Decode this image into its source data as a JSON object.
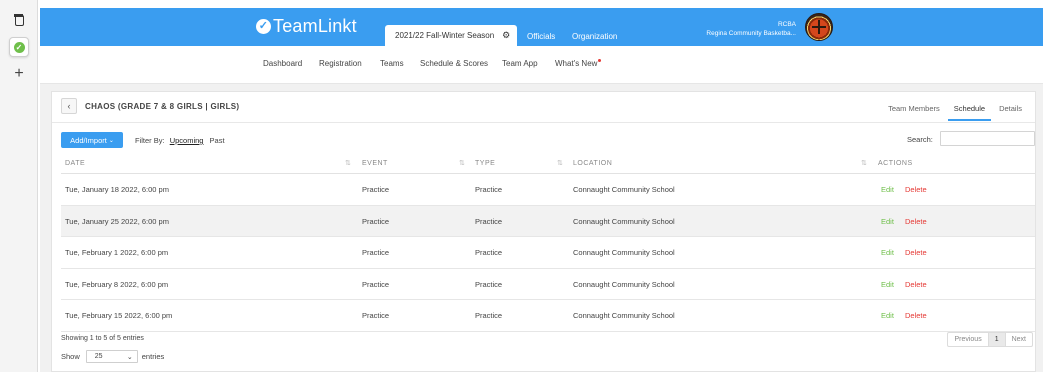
{
  "header": {
    "brand": "TeamLinkt",
    "season": "2021/22 Fall-Winter Season",
    "links": {
      "officials": "Officials",
      "organization": "Organization"
    },
    "org_abbrev": "RCBA",
    "org_name": "Regina Community Basketba..."
  },
  "subnav": {
    "dashboard": "Dashboard",
    "registration": "Registration",
    "teams": "Teams",
    "schedule": "Schedule & Scores",
    "team_app": "Team App",
    "whats_new": "What's New"
  },
  "team": {
    "title": "CHAOS (GRADE 7 & 8 GIRLS | GIRLS)",
    "tabs": {
      "members": "Team Members",
      "schedule": "Schedule",
      "details": "Details"
    }
  },
  "toolbar": {
    "add_import": "Add/Import",
    "filter_label": "Filter By:",
    "filter_upcoming": "Upcoming",
    "filter_past": "Past",
    "search_label": "Search:",
    "search_value": ""
  },
  "table": {
    "headers": {
      "date": "DATE",
      "event": "EVENT",
      "type": "TYPE",
      "location": "LOCATION",
      "actions": "ACTIONS"
    },
    "action_edit": "Edit",
    "action_delete": "Delete",
    "rows": [
      {
        "date": "Tue, January 18 2022, 6:00 pm",
        "event": "Practice",
        "type": "Practice",
        "location": "Connaught Community School"
      },
      {
        "date": "Tue, January 25 2022, 6:00 pm",
        "event": "Practice",
        "type": "Practice",
        "location": "Connaught Community School"
      },
      {
        "date": "Tue, February 1 2022, 6:00 pm",
        "event": "Practice",
        "type": "Practice",
        "location": "Connaught Community School"
      },
      {
        "date": "Tue, February 8 2022, 6:00 pm",
        "event": "Practice",
        "type": "Practice",
        "location": "Connaught Community School"
      },
      {
        "date": "Tue, February 15 2022, 6:00 pm",
        "event": "Practice",
        "type": "Practice",
        "location": "Connaught Community School"
      }
    ]
  },
  "footer": {
    "showing": "Showing 1 to 5 of 5 entries",
    "show_label": "Show",
    "length_value": "25",
    "entries_label": "entries",
    "pager": {
      "previous": "Previous",
      "page": "1",
      "next": "Next"
    }
  },
  "icons": {
    "pages": "pages-icon",
    "app": "check-circle-icon",
    "plus": "plus-icon",
    "gear": "gear-icon",
    "back": "chevron-left-icon",
    "sort": "sort-icon",
    "caret": "chevron-down-icon"
  },
  "colors": {
    "brand_blue": "#3a9df0",
    "edit_green": "#6fbf4a",
    "delete_red": "#e53935"
  }
}
